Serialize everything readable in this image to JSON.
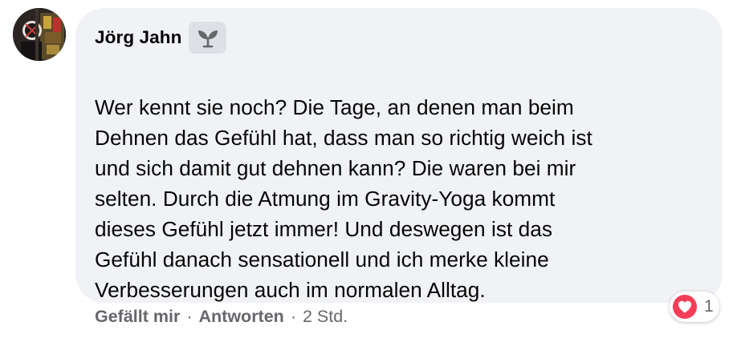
{
  "comment": {
    "author": "Jörg Jahn",
    "badge_icon": "sprout-icon",
    "text": "Wer kennt sie noch? Die Tage, an denen man beim\nDehnen das Gefühl hat, dass man so richtig weich ist\nund sich damit gut dehnen kann? Die waren bei mir\nselten. Durch die Atmung im Gravity-Yoga kommt\ndieses Gefühl jetzt immer! Und deswegen ist das\nGefühl danach sensationell und ich merke kleine\nVerbesserungen auch im normalen Alltag."
  },
  "actions": {
    "like_label": "Gefällt mir",
    "reply_label": "Antworten",
    "separator": "·",
    "timestamp": "2 Std."
  },
  "reaction": {
    "icon": "heart-icon",
    "count": "1",
    "color": "#f33e58"
  },
  "colors": {
    "bubble_bg": "#f0f2f5",
    "text": "#050505",
    "secondary_text": "#65676b",
    "badge_bg": "#dde0e5"
  }
}
